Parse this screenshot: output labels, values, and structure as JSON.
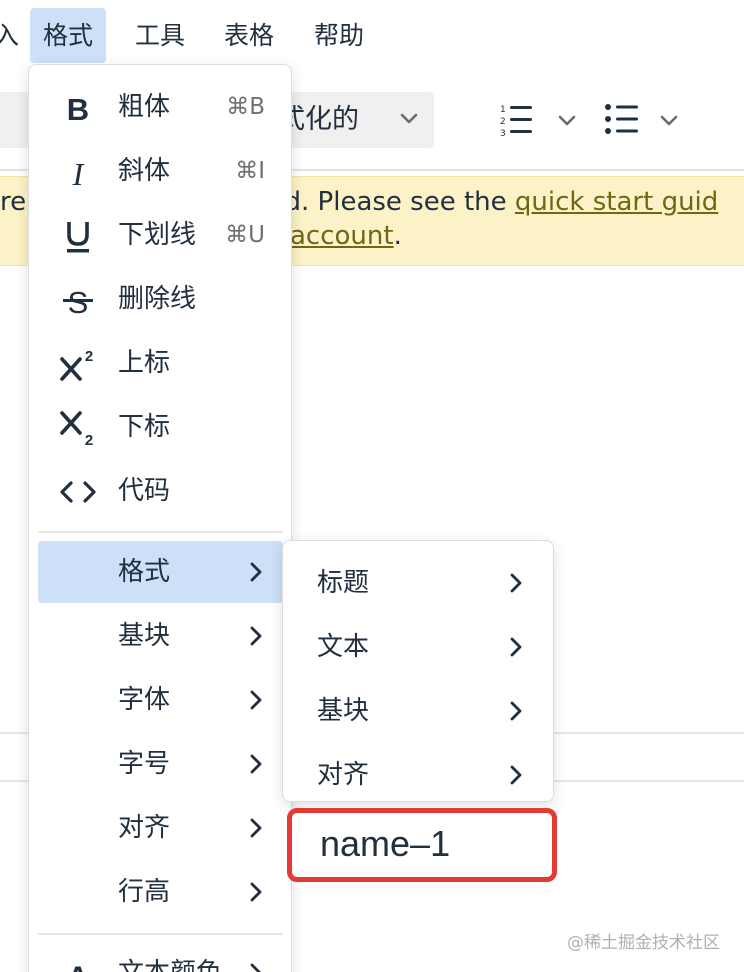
{
  "menubar": {
    "items": [
      {
        "label": "入"
      },
      {
        "label": "格式"
      },
      {
        "label": "工具"
      },
      {
        "label": "表格"
      },
      {
        "label": "帮助"
      }
    ]
  },
  "toolbar": {
    "block_format_value": "式化的"
  },
  "notice": {
    "line1_text": "re",
    "line1_text_b": "oud. Please see the ",
    "line1_link": "quick start guid",
    "line2_link": "account",
    "line2_tail": "."
  },
  "format_menu": {
    "items": [
      {
        "label": "粗体",
        "shortcut": "⌘B",
        "icon": "bold-icon"
      },
      {
        "label": "斜体",
        "shortcut": "⌘I",
        "icon": "italic-icon"
      },
      {
        "label": "下划线",
        "shortcut": "⌘U",
        "icon": "underline-icon"
      },
      {
        "label": "删除线",
        "shortcut": "",
        "icon": "strikethrough-icon"
      },
      {
        "label": "上标",
        "shortcut": "",
        "icon": "superscript-icon"
      },
      {
        "label": "下标",
        "shortcut": "",
        "icon": "subscript-icon"
      },
      {
        "label": "代码",
        "shortcut": "",
        "icon": "code-icon"
      }
    ],
    "submenus": [
      {
        "label": "格式"
      },
      {
        "label": "基块"
      },
      {
        "label": "字体"
      },
      {
        "label": "字号"
      },
      {
        "label": "对齐"
      },
      {
        "label": "行高"
      }
    ],
    "last_item": {
      "label": "文本颜色",
      "icon": "text-color-icon"
    }
  },
  "formats_submenu": {
    "items": [
      {
        "label": "标题"
      },
      {
        "label": "文本"
      },
      {
        "label": "基块"
      },
      {
        "label": "对齐"
      }
    ],
    "custom_item": {
      "label": "name–1"
    }
  },
  "watermark": "@稀土掘金技术社区",
  "colors": {
    "highlight": "#cce0f7",
    "notice_bg": "#fcf2c8",
    "annotation_red": "#e53935",
    "text": "#222f3e"
  }
}
